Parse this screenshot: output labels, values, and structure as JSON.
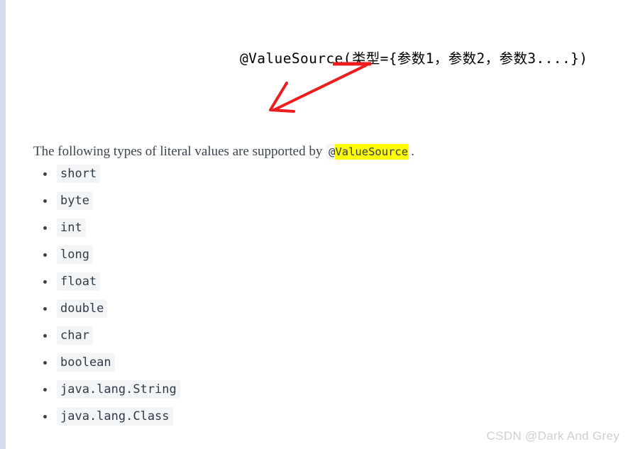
{
  "page": {
    "gutter_color": "#d3dded",
    "background_color": "#ffffff"
  },
  "annotation": {
    "heading_text": "@ValueSource(类型={参数1，参数2，参数3....})",
    "ink_color": "#ee1c1c",
    "underline_label": "red-underline-under-leixing",
    "arrow_label": "red-arrow-pointing-down-left"
  },
  "intro": {
    "text_before": "The following types of literal values are supported by ",
    "code_at": "@",
    "code_highlighted": "ValueSource",
    "text_after": ".",
    "highlight_color": "#ffff00"
  },
  "types": [
    {
      "label": "short"
    },
    {
      "label": "byte"
    },
    {
      "label": "int"
    },
    {
      "label": "long"
    },
    {
      "label": "float"
    },
    {
      "label": "double"
    },
    {
      "label": "char"
    },
    {
      "label": "boolean"
    },
    {
      "label": "java.lang.String"
    },
    {
      "label": "java.lang.Class"
    }
  ],
  "watermark": {
    "text": "CSDN @Dark And Grey"
  }
}
